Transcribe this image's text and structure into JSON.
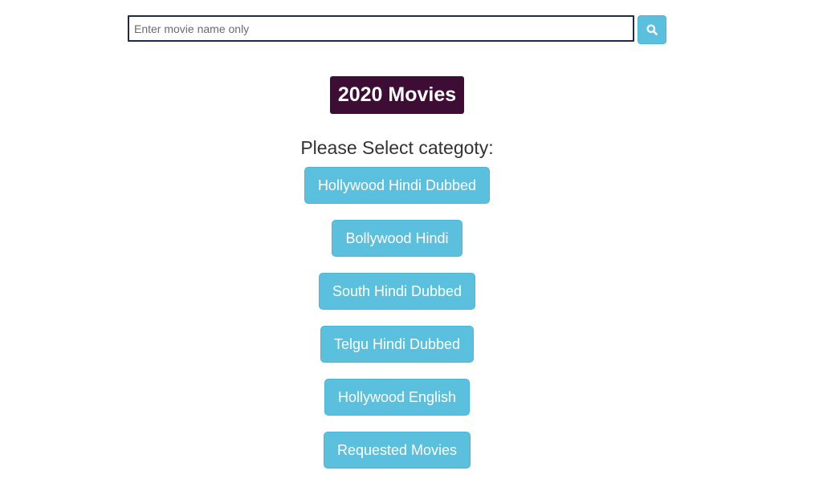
{
  "search": {
    "placeholder": "Enter movie name only",
    "value": "",
    "button_icon": "search-icon"
  },
  "title": "2020 Movies",
  "prompt": "Please Select categoty:",
  "categories": [
    {
      "label": "Hollywood Hindi Dubbed"
    },
    {
      "label": "Bollywood Hindi"
    },
    {
      "label": "South Hindi Dubbed"
    },
    {
      "label": "Telgu Hindi Dubbed"
    },
    {
      "label": "Hollywood English"
    },
    {
      "label": "Requested Movies"
    }
  ],
  "colors": {
    "button": "#5bc0de",
    "title_badge": "#3d0d35",
    "input_border": "#1f2b45"
  }
}
